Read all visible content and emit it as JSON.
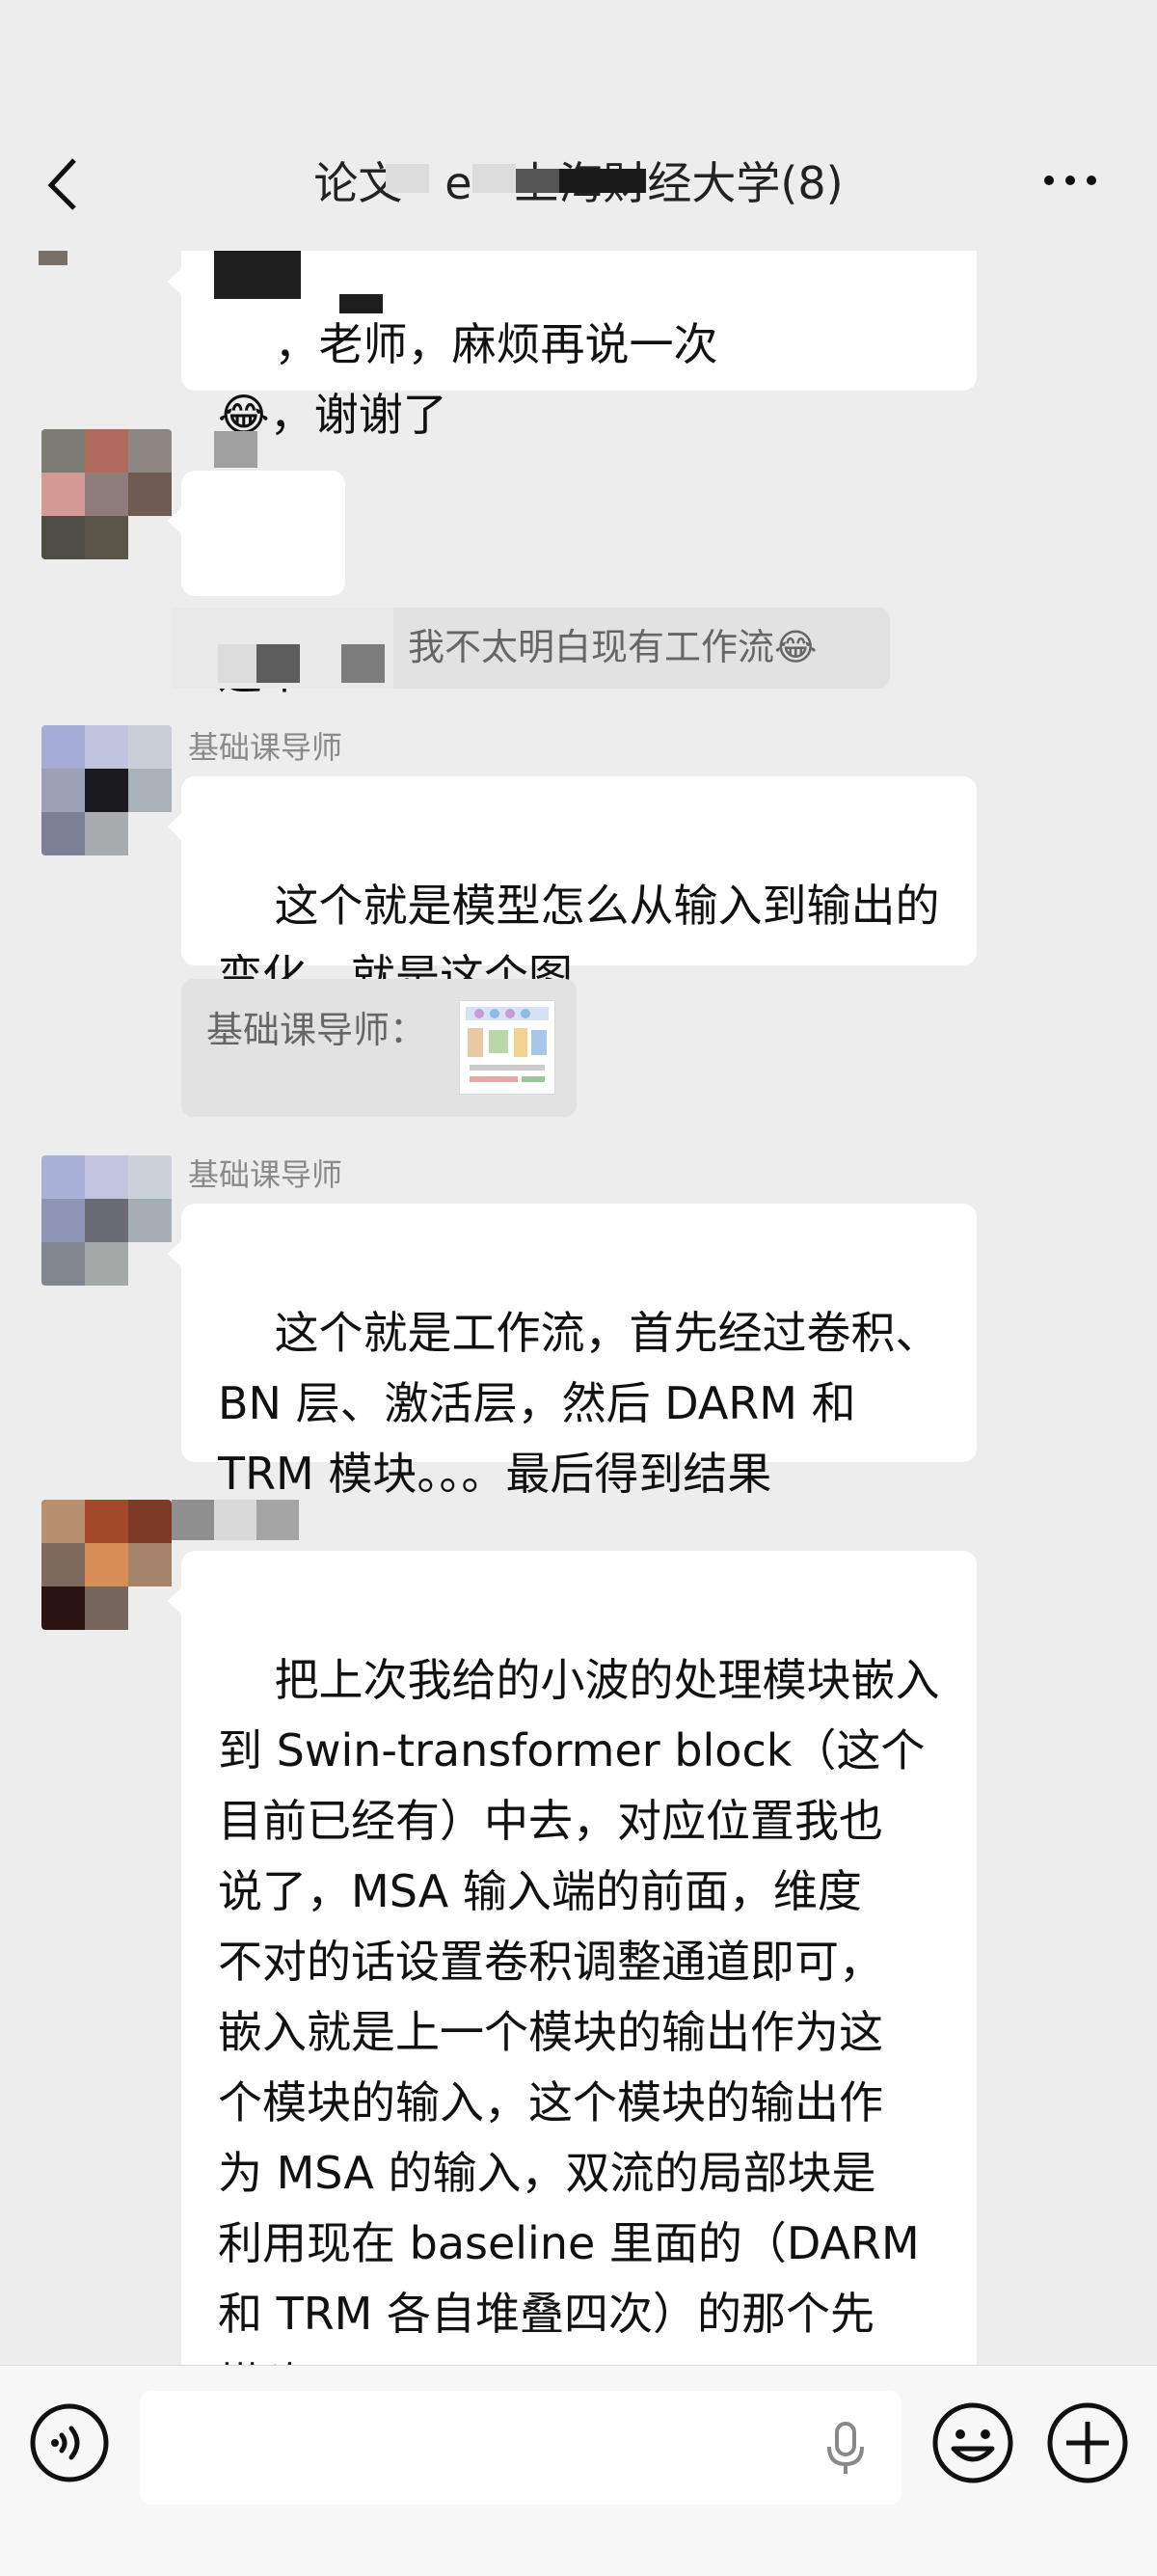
{
  "header": {
    "title": "论文 ·  e  ·  上海财经大学(8)"
  },
  "messages": {
    "m0_text": "，老师，麻烦再说一次\n😂，谢谢了",
    "m1_text": "这个",
    "m1_quote": "我不太明白现有工作流😂",
    "m2_sender": "基础课导师",
    "m2_text": "这个就是模型怎么从输入到输出的\n变化，就是这个图",
    "m2_quote_label": "基础课导师：",
    "m3_sender": "基础课导师",
    "m3_text": "这个就是工作流，首先经过卷积、\nBN 层、激活层，然后 DARM 和\nTRM 模块。。。最后得到结果",
    "m4_text": "把上次我给的小波的处理模块嵌入\n到 Swin-transformer block（这个\n目前已经有）中去，对应位置我也\n说了，MSA 输入端的前面，维度\n不对的话设置卷积调整通道即可，\n嵌入就是上一个模块的输出作为这\n个模块的输入，这个模块的输出作\n为 MSA 的输入，双流的局部块是\n利用现在 baseline 里面的（DARM\n和 TRM 各自堆叠四次）的那个先\n搭建"
  },
  "input_bar": {
    "placeholder": ""
  },
  "icons": {
    "back": "back-arrow-icon",
    "more": "more-dots-icon",
    "voice": "voice-mode-icon",
    "mic": "microphone-icon",
    "emoji": "emoji-icon",
    "plus": "plus-icon"
  },
  "colors": {
    "background": "#ededed",
    "bubble": "#ffffff",
    "quote": "#e2e2e2",
    "sender": "#8a8a8a"
  }
}
